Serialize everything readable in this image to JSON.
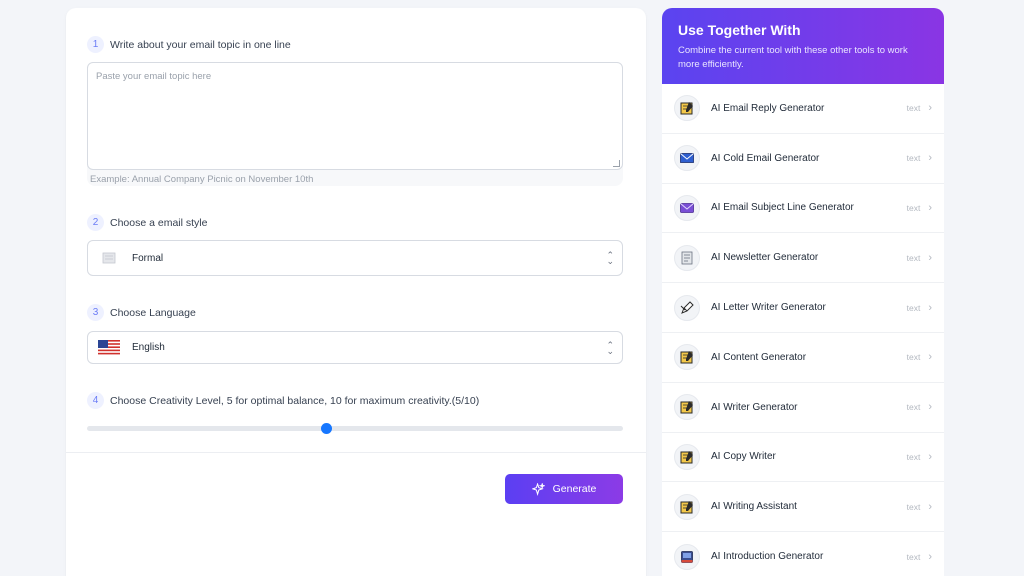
{
  "form": {
    "step1": {
      "num": "1",
      "label": "Write about your email topic in one line"
    },
    "topic": {
      "placeholder": "Paste your email topic here",
      "example": "Example:  Annual Company Picnic on November 10th"
    },
    "step2": {
      "num": "2",
      "label": "Choose a email style"
    },
    "style": {
      "value": "Formal",
      "icon": "document-icon"
    },
    "step3": {
      "num": "3",
      "label": "Choose Language"
    },
    "language": {
      "value": "English",
      "icon": "us-flag-icon"
    },
    "step4": {
      "num": "4",
      "label": "Choose Creativity Level, 5 for optimal balance, 10 for maximum creativity.(5/10)"
    },
    "creativity": {
      "value": 5,
      "max": 10,
      "fraction": 0.445
    },
    "generate_label": "Generate"
  },
  "sidebar": {
    "title": "Use Together With",
    "subtitle": "Combine the current tool with these other tools to work more efficiently.",
    "items": [
      {
        "name": "AI Email Reply Generator",
        "tag": "text",
        "icon": "notepad-icon"
      },
      {
        "name": "AI Cold Email Generator",
        "tag": "text",
        "icon": "envelope-icon"
      },
      {
        "name": "AI Email Subject Line Generator",
        "tag": "text",
        "icon": "purple-envelope-icon"
      },
      {
        "name": "AI Newsletter Generator",
        "tag": "text",
        "icon": "newspaper-icon"
      },
      {
        "name": "AI Letter Writer Generator",
        "tag": "text",
        "icon": "pen-icon"
      },
      {
        "name": "AI Content Generator",
        "tag": "text",
        "icon": "notepad-icon"
      },
      {
        "name": "AI Writer Generator",
        "tag": "text",
        "icon": "notepad-icon"
      },
      {
        "name": "AI Copy Writer",
        "tag": "text",
        "icon": "notepad-icon"
      },
      {
        "name": "AI Writing Assistant",
        "tag": "text",
        "icon": "notepad-icon"
      },
      {
        "name": "AI Introduction Generator",
        "tag": "text",
        "icon": "book-icon"
      }
    ]
  },
  "colors": {
    "accent_start": "#5b3ff3",
    "accent_end": "#8c3be6",
    "slider": "#1677ff"
  }
}
